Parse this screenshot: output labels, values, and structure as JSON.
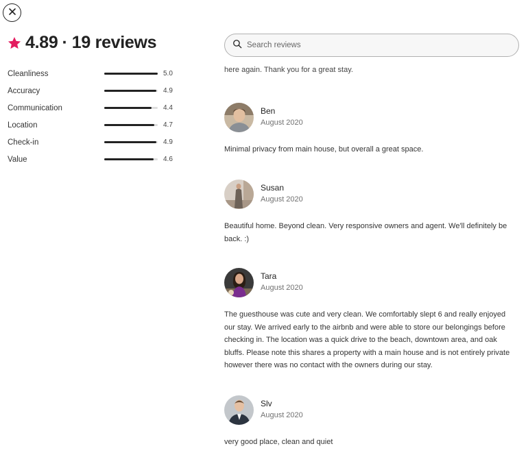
{
  "close": {
    "icon": "close-icon"
  },
  "summary": {
    "icon": "star-icon",
    "rating": "4.89",
    "separator": "·",
    "count": "19 reviews",
    "accent_color": "#E31C5F"
  },
  "categories": [
    {
      "label": "Cleanliness",
      "value": "5.0",
      "score": 5.0
    },
    {
      "label": "Accuracy",
      "value": "4.9",
      "score": 4.9
    },
    {
      "label": "Communication",
      "value": "4.4",
      "score": 4.4
    },
    {
      "label": "Location",
      "value": "4.7",
      "score": 4.7
    },
    {
      "label": "Check-in",
      "value": "4.9",
      "score": 4.9
    },
    {
      "label": "Value",
      "value": "4.6",
      "score": 4.6
    }
  ],
  "search": {
    "placeholder": "Search reviews",
    "value": "",
    "icon": "search-icon"
  },
  "partial_review_text": "here again. Thank you for a great stay.",
  "reviews": [
    {
      "name": "Ben",
      "date": "August 2020",
      "text": "Minimal privacy from main house, but overall a great space."
    },
    {
      "name": "Susan",
      "date": "August 2020",
      "text": "Beautiful home. Beyond clean. Very responsive owners and agent. We'll definitely be back. :)"
    },
    {
      "name": "Tara",
      "date": "August 2020",
      "text": "The guesthouse was cute and very clean. We comfortably slept 6 and really enjoyed our stay. We arrived early to the airbnb and were able to store our belongings before checking in. The location was a quick drive to the beach, downtown area, and oak bluffs. Please note this shares a property with a main house and is not entirely private however there was no contact with the owners during our stay."
    },
    {
      "name": "Slv",
      "date": "August 2020",
      "text": "very good place, clean and quiet"
    }
  ]
}
